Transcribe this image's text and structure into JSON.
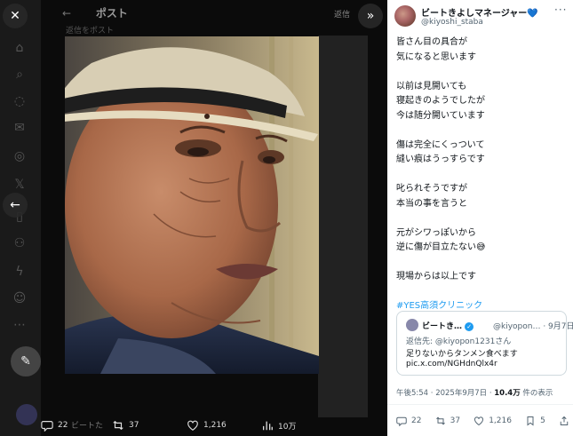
{
  "background": {
    "header_title": "ポスト",
    "header_right": "返信",
    "subtext": "返信をポスト",
    "bottom_text": "ビートた",
    "actions": {
      "replies": "22",
      "reposts": "37",
      "likes": "1,216",
      "views": "10万"
    }
  },
  "panel": {
    "author_name": "ビートきよしマネージャー",
    "author_heart": "💙",
    "author_handle": "@kiyoshi_staba",
    "body": [
      "皆さん目の具合が",
      "気になると思います",
      "",
      "以前は見開いても",
      "寝起きのようでしたが",
      "今は随分開いています",
      "",
      "傷は完全にくっついて",
      "縫い痕はうっすらです",
      "",
      "叱られそうですが",
      "本当の事を言うと",
      "",
      "元がシワっぽいから",
      "逆に傷が目立たない😅",
      "",
      "現場からは以上です",
      "",
      "#YES高須クリニック"
    ],
    "quote": {
      "name": "ビートき…",
      "handle": "@kiyopon… · 9月7日",
      "reply_prefix": "返信先:",
      "reply_to": "@kiyopon1231さん",
      "text": "足りないからタンメン食べます",
      "link": "pic.x.com/NGHdnQlx4r"
    },
    "meta": {
      "time": "午後5:54 · 2025年9月7日 · ",
      "views": "10.4万",
      "views_suffix": " 件の表示"
    },
    "actions": {
      "replies": "22",
      "reposts": "37",
      "likes": "1,216",
      "bookmarks": "5"
    }
  },
  "colors": {
    "accent": "#1d9bf0",
    "text_secondary": "#536471"
  }
}
